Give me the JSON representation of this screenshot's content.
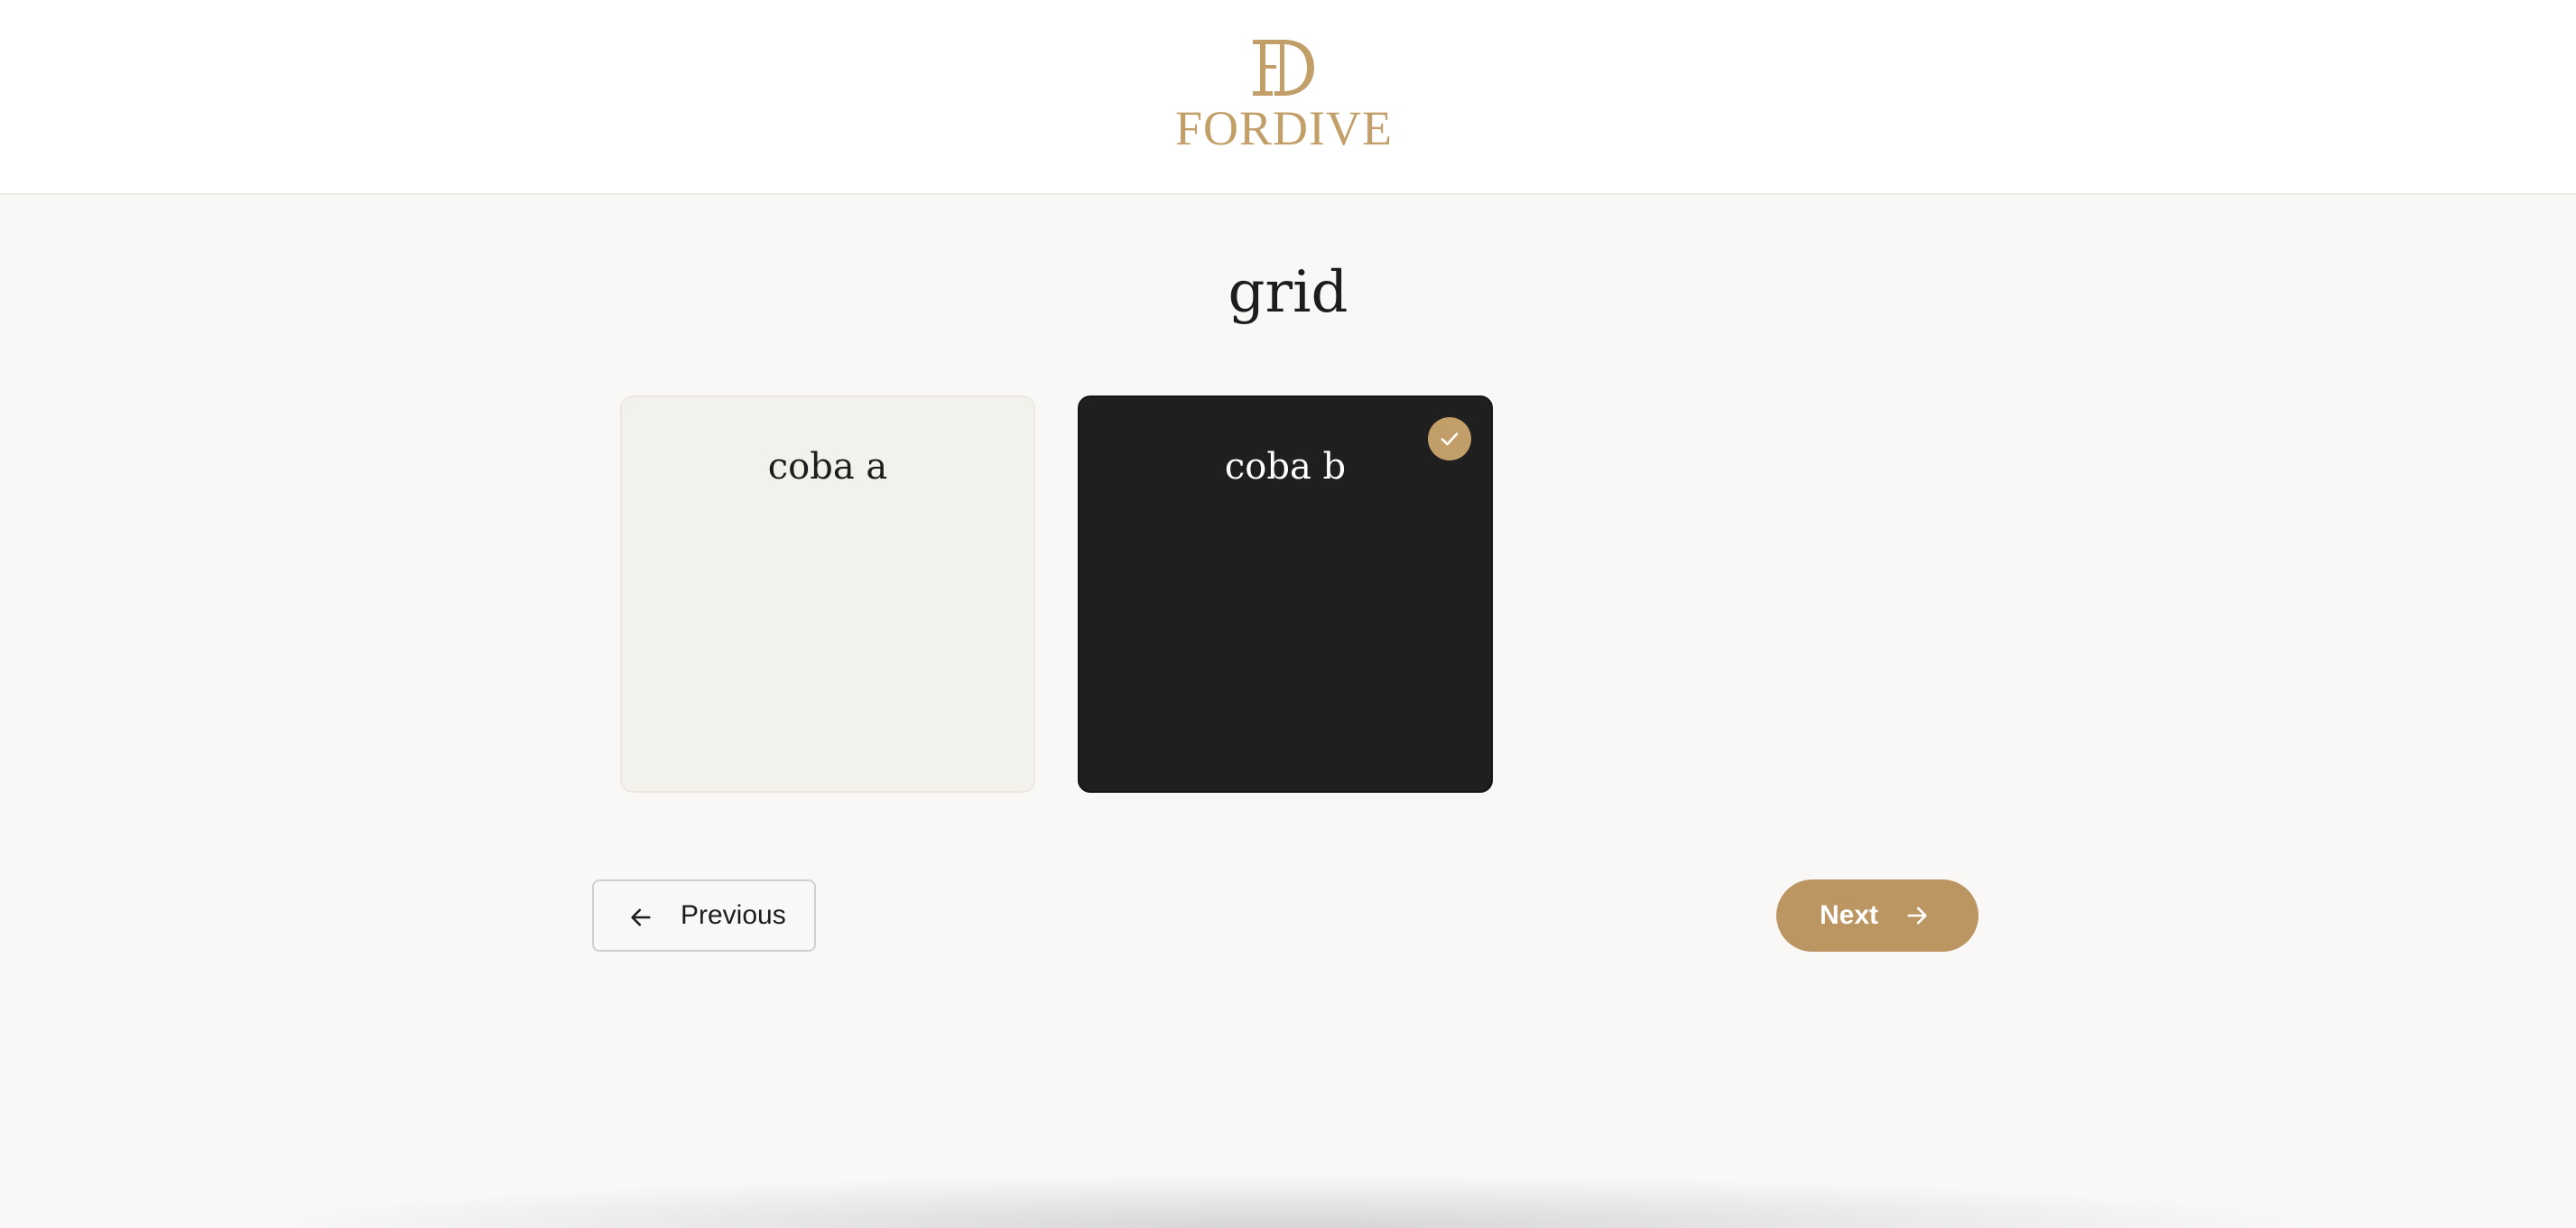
{
  "header": {
    "logo": {
      "monogram": "FD",
      "wordmark": "FORDIVE",
      "icon": "fordive-logo-icon"
    }
  },
  "main": {
    "title": "grid",
    "options": [
      {
        "label": "coba a",
        "selected": false,
        "background": "#f3f1eb"
      },
      {
        "label": "coba b",
        "selected": true,
        "background": "#1f1f1f"
      }
    ],
    "selected_badge_icon": "check-icon"
  },
  "navigation": {
    "previous": {
      "label": "Previous",
      "icon": "arrow-left-icon"
    },
    "next": {
      "label": "Next",
      "icon": "arrow-right-icon"
    }
  },
  "colors": {
    "accent": "#bb9663",
    "logo": "#c29f68",
    "page_background": "#f9f8f6",
    "header_background": "#ffffff"
  }
}
